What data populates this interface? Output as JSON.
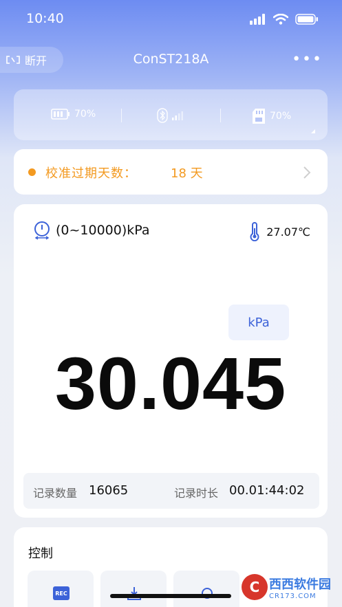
{
  "status_bar": {
    "time": "10:40"
  },
  "header": {
    "disconnect_label": "断开",
    "title": "ConST218A",
    "more_label": "•••"
  },
  "device_status": {
    "battery": "70%",
    "storage": "70%"
  },
  "alert": {
    "label": "校准过期天数：",
    "value": "18 天"
  },
  "measurement": {
    "range": "(0~10000)kPa",
    "temperature": "27.07℃",
    "unit": "kPa",
    "reading": "30.045",
    "record_count_label": "记录数量",
    "record_count": "16065",
    "record_duration_label": "记录时长",
    "record_duration": "00.01:44:02"
  },
  "control": {
    "title": "控制",
    "rec_label": "REC"
  },
  "watermark": {
    "main": "西西软件园",
    "sub": "CR173.COM"
  },
  "colors": {
    "accent": "#3c62d8",
    "alert": "#f39a21"
  }
}
